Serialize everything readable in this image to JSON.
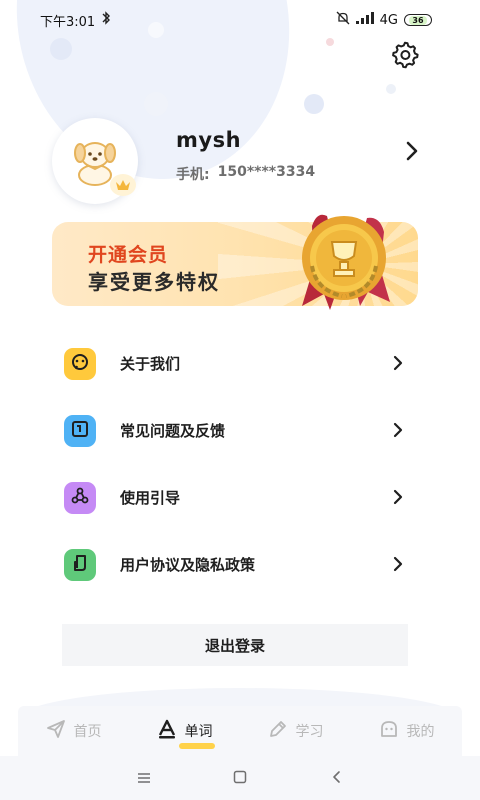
{
  "status_bar": {
    "time": "下午3:01",
    "network": "4G",
    "battery": "36"
  },
  "profile": {
    "username": "mysh",
    "phone_label": "手机:",
    "phone_value": "150****3334"
  },
  "vip_banner": {
    "title": "开通会员",
    "subtitle": "享受更多特权"
  },
  "menu": {
    "items": [
      {
        "label": "关于我们",
        "icon": "chat-bubble-icon",
        "color": "#ffc93c"
      },
      {
        "label": "常见问题及反馈",
        "icon": "feedback-icon",
        "color": "#4fb2f5"
      },
      {
        "label": "使用引导",
        "icon": "guide-nodes-icon",
        "color": "#c58af5"
      },
      {
        "label": "用户协议及隐私政策",
        "icon": "document-icon",
        "color": "#5fc97a"
      }
    ]
  },
  "logout_label": "退出登录",
  "tabbar": {
    "tabs": [
      {
        "label": "首页",
        "icon": "paper-plane-icon",
        "active": false
      },
      {
        "label": "单词",
        "icon": "letter-a-icon",
        "active": true
      },
      {
        "label": "学习",
        "icon": "pencil-icon",
        "active": false
      },
      {
        "label": "我的",
        "icon": "ghost-icon",
        "active": false
      }
    ]
  },
  "colors": {
    "accent": "#ffd24a",
    "vip_title": "#e0461f"
  }
}
